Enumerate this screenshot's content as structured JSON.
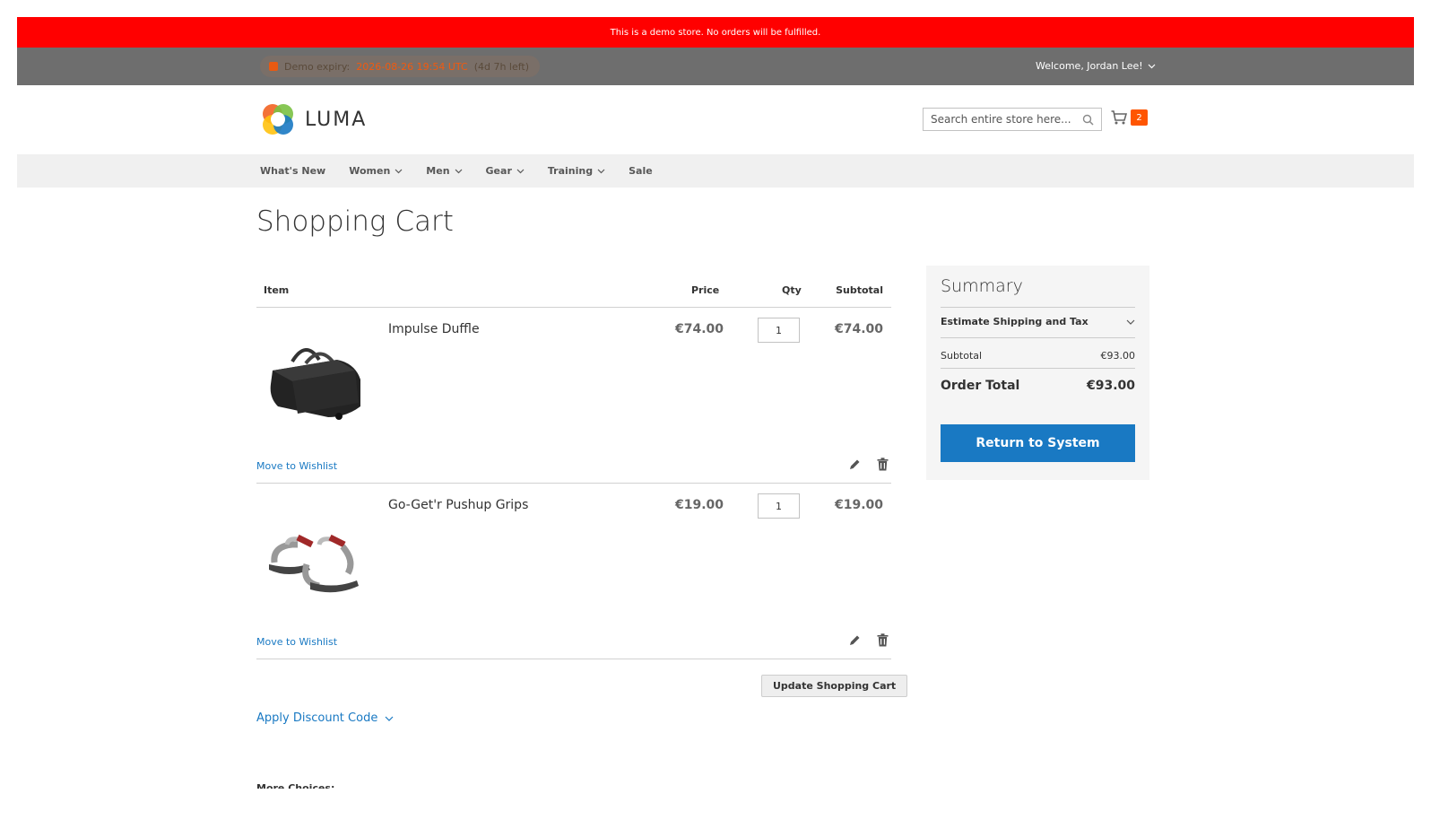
{
  "demo_notice": "This is a demo store. No orders will be fulfilled.",
  "top_bar": {
    "expiry_label": "Demo expiry:",
    "expiry_date": "2026-08-26 19:54 UTC",
    "expiry_left": "(4d 7h left)",
    "welcome": "Welcome, Jordan Lee!"
  },
  "header": {
    "logo_text": "LUMA",
    "search_placeholder": "Search entire store here...",
    "cart_count": "2"
  },
  "nav": {
    "items": [
      {
        "label": "What's New",
        "has_dropdown": false
      },
      {
        "label": "Women",
        "has_dropdown": true
      },
      {
        "label": "Men",
        "has_dropdown": true
      },
      {
        "label": "Gear",
        "has_dropdown": true
      },
      {
        "label": "Training",
        "has_dropdown": true
      },
      {
        "label": "Sale",
        "has_dropdown": false
      }
    ]
  },
  "page_title": "Shopping Cart",
  "cart": {
    "headers": {
      "item": "Item",
      "price": "Price",
      "qty": "Qty",
      "subtotal": "Subtotal"
    },
    "items": [
      {
        "name": "Impulse Duffle",
        "price": "€74.00",
        "qty": "1",
        "subtotal": "€74.00",
        "wishlist": "Move to Wishlist"
      },
      {
        "name": "Go-Get'r Pushup Grips",
        "price": "€19.00",
        "qty": "1",
        "subtotal": "€19.00",
        "wishlist": "Move to Wishlist"
      }
    ],
    "update_label": "Update Shopping Cart",
    "discount_label": "Apply Discount Code",
    "more_choices": "More Choices:"
  },
  "summary": {
    "title": "Summary",
    "estimate_label": "Estimate Shipping and Tax",
    "subtotal_label": "Subtotal",
    "subtotal_value": "€93.00",
    "order_total_label": "Order Total",
    "order_total_value": "€93.00",
    "button_label": "Return to System"
  },
  "colors": {
    "demo_bar": "#ff0000",
    "top_bar": "#6e6e6e",
    "accent_link": "#1979c3",
    "cart_badge": "#ff5501"
  }
}
